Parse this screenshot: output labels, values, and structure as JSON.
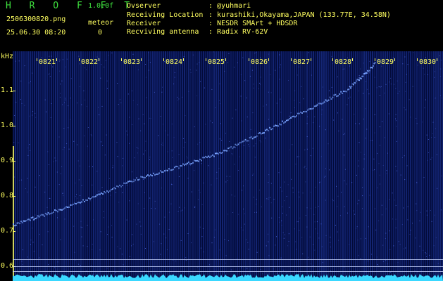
{
  "header": {
    "app_title": "H R O F F T",
    "version": "1.0.0f",
    "filename": "2506300820.png",
    "meteor_label": "meteor",
    "datetime": "25.06.30 08:20",
    "meteor_count": "0",
    "info": [
      {
        "key": "Ovserver",
        "value": ": @yuhmari"
      },
      {
        "key": "Receiving Location",
        "value": ": kurashiki,Okayama,JAPAN (133.77E, 34.58N)"
      },
      {
        "key": "Receiver",
        "value": ": NESDR SMArt + HDSDR"
      },
      {
        "key": "Recviving antenna",
        "value": ": Radix RV-62V"
      }
    ]
  },
  "chart_data": {
    "type": "heatmap",
    "ylabel": "kHz",
    "y_ticks": [
      "1.1",
      "1.0",
      "0.9",
      "0.8",
      "0.7",
      "0.6"
    ],
    "x_ticks": [
      "0821",
      "0822",
      "0823",
      "0824",
      "0825",
      "0826",
      "0827",
      "0828",
      "0829",
      "0830"
    ],
    "ylim": [
      0.57,
      1.19
    ],
    "signal_trace": {
      "x": [
        "0820",
        "0821",
        "0822",
        "0823",
        "0824",
        "0825",
        "0826",
        "0827",
        "0828",
        "0828.8"
      ],
      "y": [
        0.72,
        0.755,
        0.8,
        0.85,
        0.885,
        0.925,
        0.985,
        1.045,
        1.105,
        1.18
      ]
    },
    "reference_lines_khz": [
      0.62,
      0.6
    ],
    "colors": {
      "background": "#020a38",
      "noise": "#2f4fd0",
      "signal": "#7aa4ff",
      "text": "#ffff60",
      "title": "#3ee03e",
      "spectrum": "#3ad8ff"
    }
  }
}
